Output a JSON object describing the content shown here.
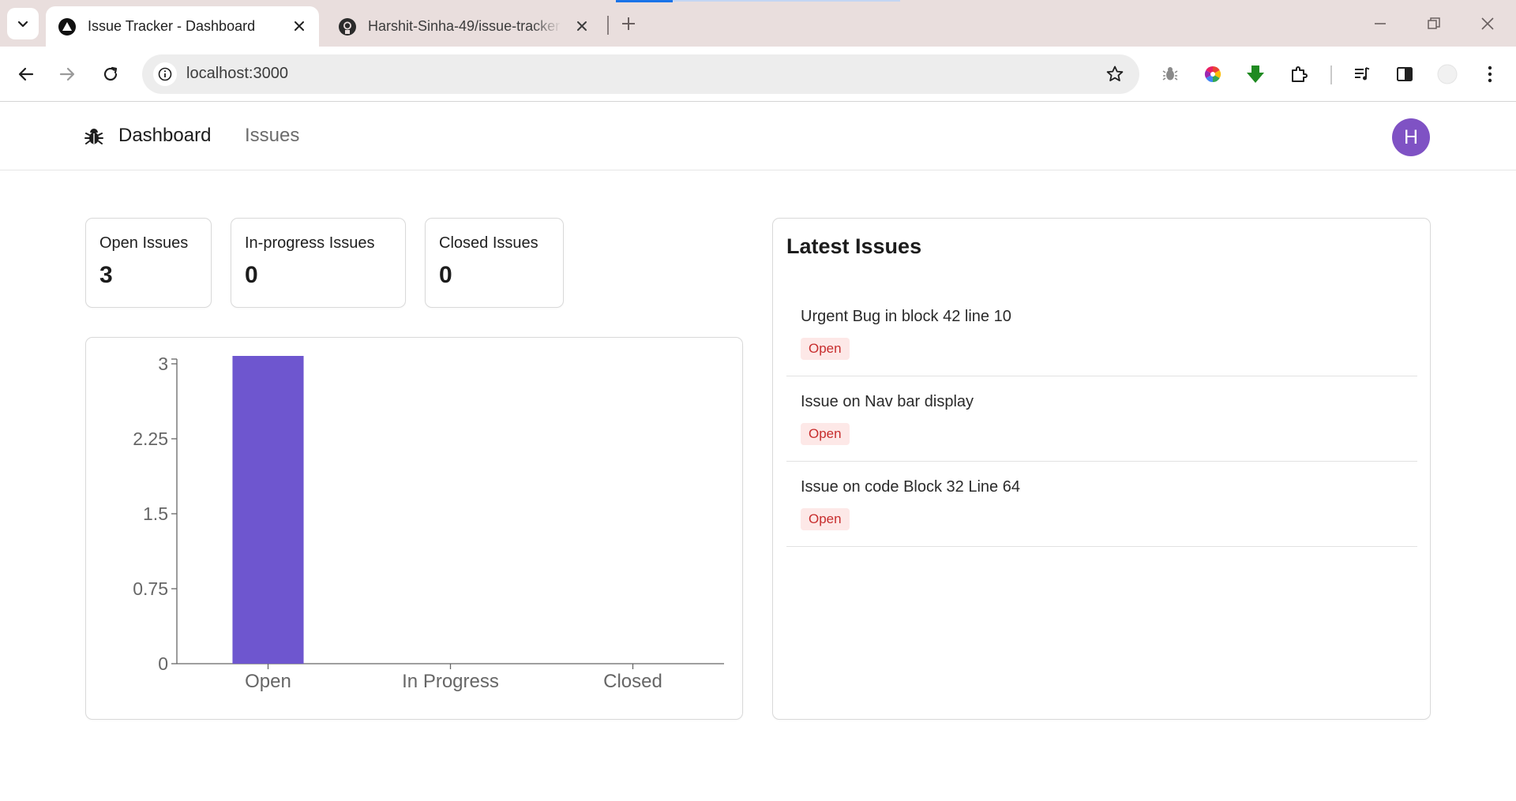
{
  "browser": {
    "tabs": [
      {
        "title": "Issue Tracker - Dashboard",
        "active": true,
        "icon": "triangle-logo-icon"
      },
      {
        "title": "Harshit-Sinha-49/issue-tracker:",
        "active": false,
        "icon": "github-icon"
      }
    ],
    "address": "localhost:3000"
  },
  "nav": {
    "dashboard_label": "Dashboard",
    "issues_label": "Issues",
    "avatar_initial": "H"
  },
  "stats": [
    {
      "label": "Open Issues",
      "value": "3"
    },
    {
      "label": "In-progress Issues",
      "value": "0"
    },
    {
      "label": "Closed Issues",
      "value": "0"
    }
  ],
  "chart_data": {
    "type": "bar",
    "categories": [
      "Open",
      "In Progress",
      "Closed"
    ],
    "values": [
      3,
      0,
      0
    ],
    "yticks": [
      "0",
      "0.75",
      "1.5",
      "2.25",
      "3"
    ],
    "ylim": [
      0,
      3
    ],
    "bar_color": "#6e56cf",
    "grid": false
  },
  "latest": {
    "title": "Latest Issues",
    "items": [
      {
        "title": "Urgent Bug in block 42 line 10",
        "status": "Open"
      },
      {
        "title": "Issue on Nav bar display",
        "status": "Open"
      },
      {
        "title": "Issue on code Block 32 Line 64",
        "status": "Open"
      }
    ]
  },
  "colors": {
    "accent": "#6e56cf",
    "avatar": "#7f52c4",
    "badge_bg": "#fde8e7",
    "badge_text": "#c72d2d"
  }
}
